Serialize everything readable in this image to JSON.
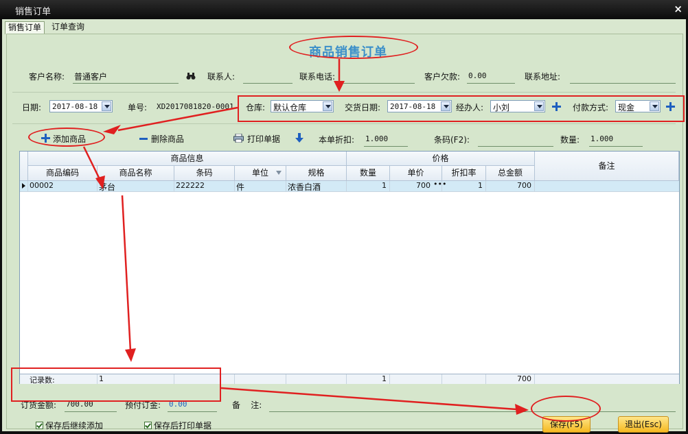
{
  "window": {
    "title": "销售订单",
    "close_label": "×"
  },
  "tabs": [
    {
      "label": "销售订单"
    },
    {
      "label": "订单查询"
    }
  ],
  "page_title": "商品销售订单",
  "customer": {
    "name_label": "客户名称:",
    "name_value": "普通客户",
    "contact_label": "联系人:",
    "contact_value": "",
    "phone_label": "联系电话:",
    "phone_value": "",
    "debt_label": "客户欠款:",
    "debt_value": "0.00",
    "address_label": "联系地址:",
    "address_value": ""
  },
  "order": {
    "date_label": "日期:",
    "date_value": "2017-08-18",
    "no_label": "单号:",
    "no_value": "XD2017081820-0001",
    "warehouse_label": "仓库:",
    "warehouse_value": "默认仓库",
    "delivery_label": "交货日期:",
    "delivery_value": "2017-08-18",
    "handler_label": "经办人:",
    "handler_value": "小刘",
    "payment_label": "付款方式:",
    "payment_value": "现金"
  },
  "toolbar": {
    "add_label": "添加商品",
    "delete_label": "删除商品",
    "print_label": "打印单据",
    "discount_label": "本单折扣:",
    "discount_value": "1.000",
    "barcode_label": "条码(F2):",
    "barcode_value": "",
    "qty_label": "数量:",
    "qty_value": "1.000"
  },
  "grid": {
    "group_product": "商品信息",
    "group_price": "价格",
    "remark_header": "备注",
    "columns": [
      "商品编码",
      "商品名称",
      "条码",
      "单位",
      "规格",
      "数量",
      "单价",
      "折扣率",
      "总金额"
    ],
    "rows": [
      {
        "code": "00002",
        "name": "茅台",
        "barcode": "222222",
        "unit": "件",
        "spec": "浓香白酒",
        "qty": "1",
        "price": "700",
        "discount": "1",
        "total": "700",
        "remark": ""
      }
    ],
    "footer": {
      "label": "记录数:",
      "count": "1",
      "qty": "1",
      "total": "700"
    }
  },
  "summary": {
    "amount_label": "订货金额:",
    "amount_value": "700.00",
    "deposit_label": "预付订金:",
    "deposit_value": "0.00",
    "remark_label": "备    注:",
    "remark_value": ""
  },
  "options": [
    {
      "label": "保存后继续添加",
      "checked": true
    },
    {
      "label": "保存后打印单据",
      "checked": true
    }
  ],
  "actions": {
    "save_label": "保存(F5)",
    "exit_label": "退出(Esc)"
  },
  "colors": {
    "annotation": "#e02020",
    "title": "#3b8fc9",
    "panel": "#d6e6cc",
    "button": "#f5b820"
  }
}
